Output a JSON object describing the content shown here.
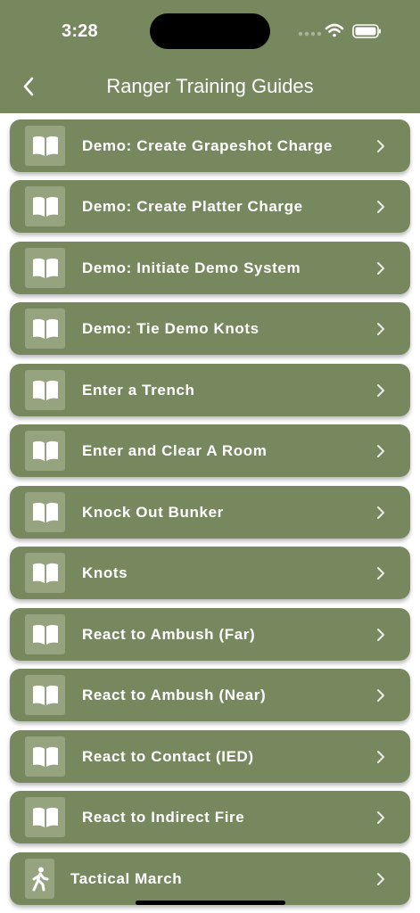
{
  "status_bar": {
    "time": "3:28",
    "icons": [
      "cellular-dots-icon",
      "wifi-icon",
      "battery-icon"
    ]
  },
  "nav": {
    "back_icon": "chevron-left-icon",
    "title": "Ranger Training Guides"
  },
  "colors": {
    "accent": "#77885f",
    "icon_tile": "#95a47f",
    "text": "#ffffff"
  },
  "items": [
    {
      "label": "Demo: Create Grapeshot Charge",
      "icon": "book-icon"
    },
    {
      "label": "Demo: Create Platter Charge",
      "icon": "book-icon"
    },
    {
      "label": "Demo: Initiate Demo System",
      "icon": "book-icon"
    },
    {
      "label": "Demo: Tie Demo Knots",
      "icon": "book-icon"
    },
    {
      "label": "Enter a Trench",
      "icon": "book-icon"
    },
    {
      "label": "Enter and Clear A Room",
      "icon": "book-icon"
    },
    {
      "label": "Knock Out Bunker",
      "icon": "book-icon"
    },
    {
      "label": "Knots",
      "icon": "book-icon"
    },
    {
      "label": "React to Ambush (Far)",
      "icon": "book-icon"
    },
    {
      "label": "React to Ambush (Near)",
      "icon": "book-icon"
    },
    {
      "label": "React to Contact (IED)",
      "icon": "book-icon"
    },
    {
      "label": "React to Indirect Fire",
      "icon": "book-icon"
    },
    {
      "label": "Tactical March",
      "icon": "walking-person-icon"
    }
  ]
}
